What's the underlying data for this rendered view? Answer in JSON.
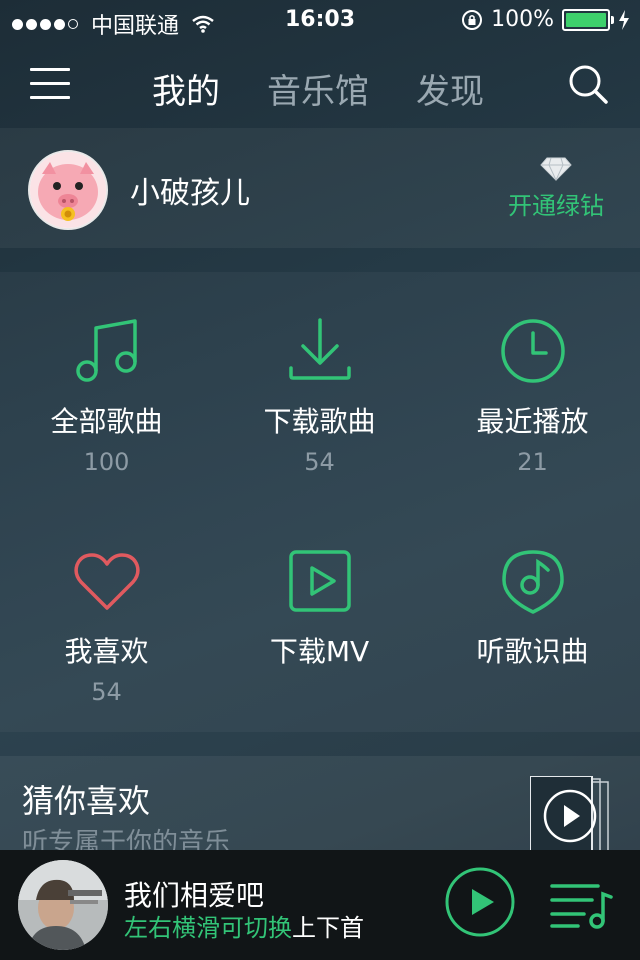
{
  "status": {
    "carrier": "中国联通",
    "time": "16:03",
    "battery": "100%"
  },
  "nav": {
    "tabs": [
      "我的",
      "音乐馆",
      "发现"
    ],
    "active_tab": "我的"
  },
  "profile": {
    "username": "小破孩儿",
    "vip_label": "开通绿钻"
  },
  "grid": [
    {
      "label": "全部歌曲",
      "count": "100",
      "icon": "music-note-icon"
    },
    {
      "label": "下载歌曲",
      "count": "54",
      "icon": "download-icon"
    },
    {
      "label": "最近播放",
      "count": "21",
      "icon": "clock-icon"
    },
    {
      "label": "我喜欢",
      "count": "54",
      "icon": "heart-icon"
    },
    {
      "label": "下载MV",
      "count": "",
      "icon": "video-play-icon"
    },
    {
      "label": "听歌识曲",
      "count": "",
      "icon": "music-recognition-icon"
    }
  ],
  "recommend": {
    "title": "猜你喜欢",
    "subtitle": "听专属于你的音乐"
  },
  "player": {
    "song": "我们相爱吧",
    "hint_green": "左右横滑可切换",
    "hint_white": "上下首"
  },
  "colors": {
    "accent": "#32c477",
    "heart": "#e05a5f",
    "background": "#253a46",
    "player_bg": "#111517"
  }
}
